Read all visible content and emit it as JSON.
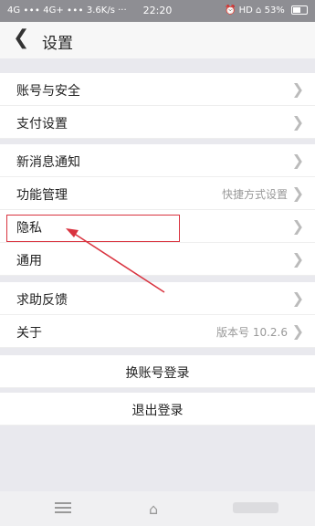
{
  "status_bar": {
    "left": "4G ∙∙∙ 4G+ ∙∙∙ 3.6K/s ···",
    "time": "22:20",
    "right": "⏰ HD ⌂ 53%"
  },
  "header": {
    "back": "❮",
    "title": "设置"
  },
  "rows": {
    "account": "账号与安全",
    "payment": "支付设置",
    "notifications": "新消息通知",
    "features": {
      "label": "功能管理",
      "value": "快捷方式设置"
    },
    "privacy": "隐私",
    "general": "通用",
    "help": "求助反馈",
    "about": {
      "label": "关于",
      "value": "版本号 10.2.6"
    },
    "switch_account": "换账号登录",
    "logout": "退出登录"
  },
  "chevron": "❯",
  "nav": {
    "home": "⌂"
  }
}
